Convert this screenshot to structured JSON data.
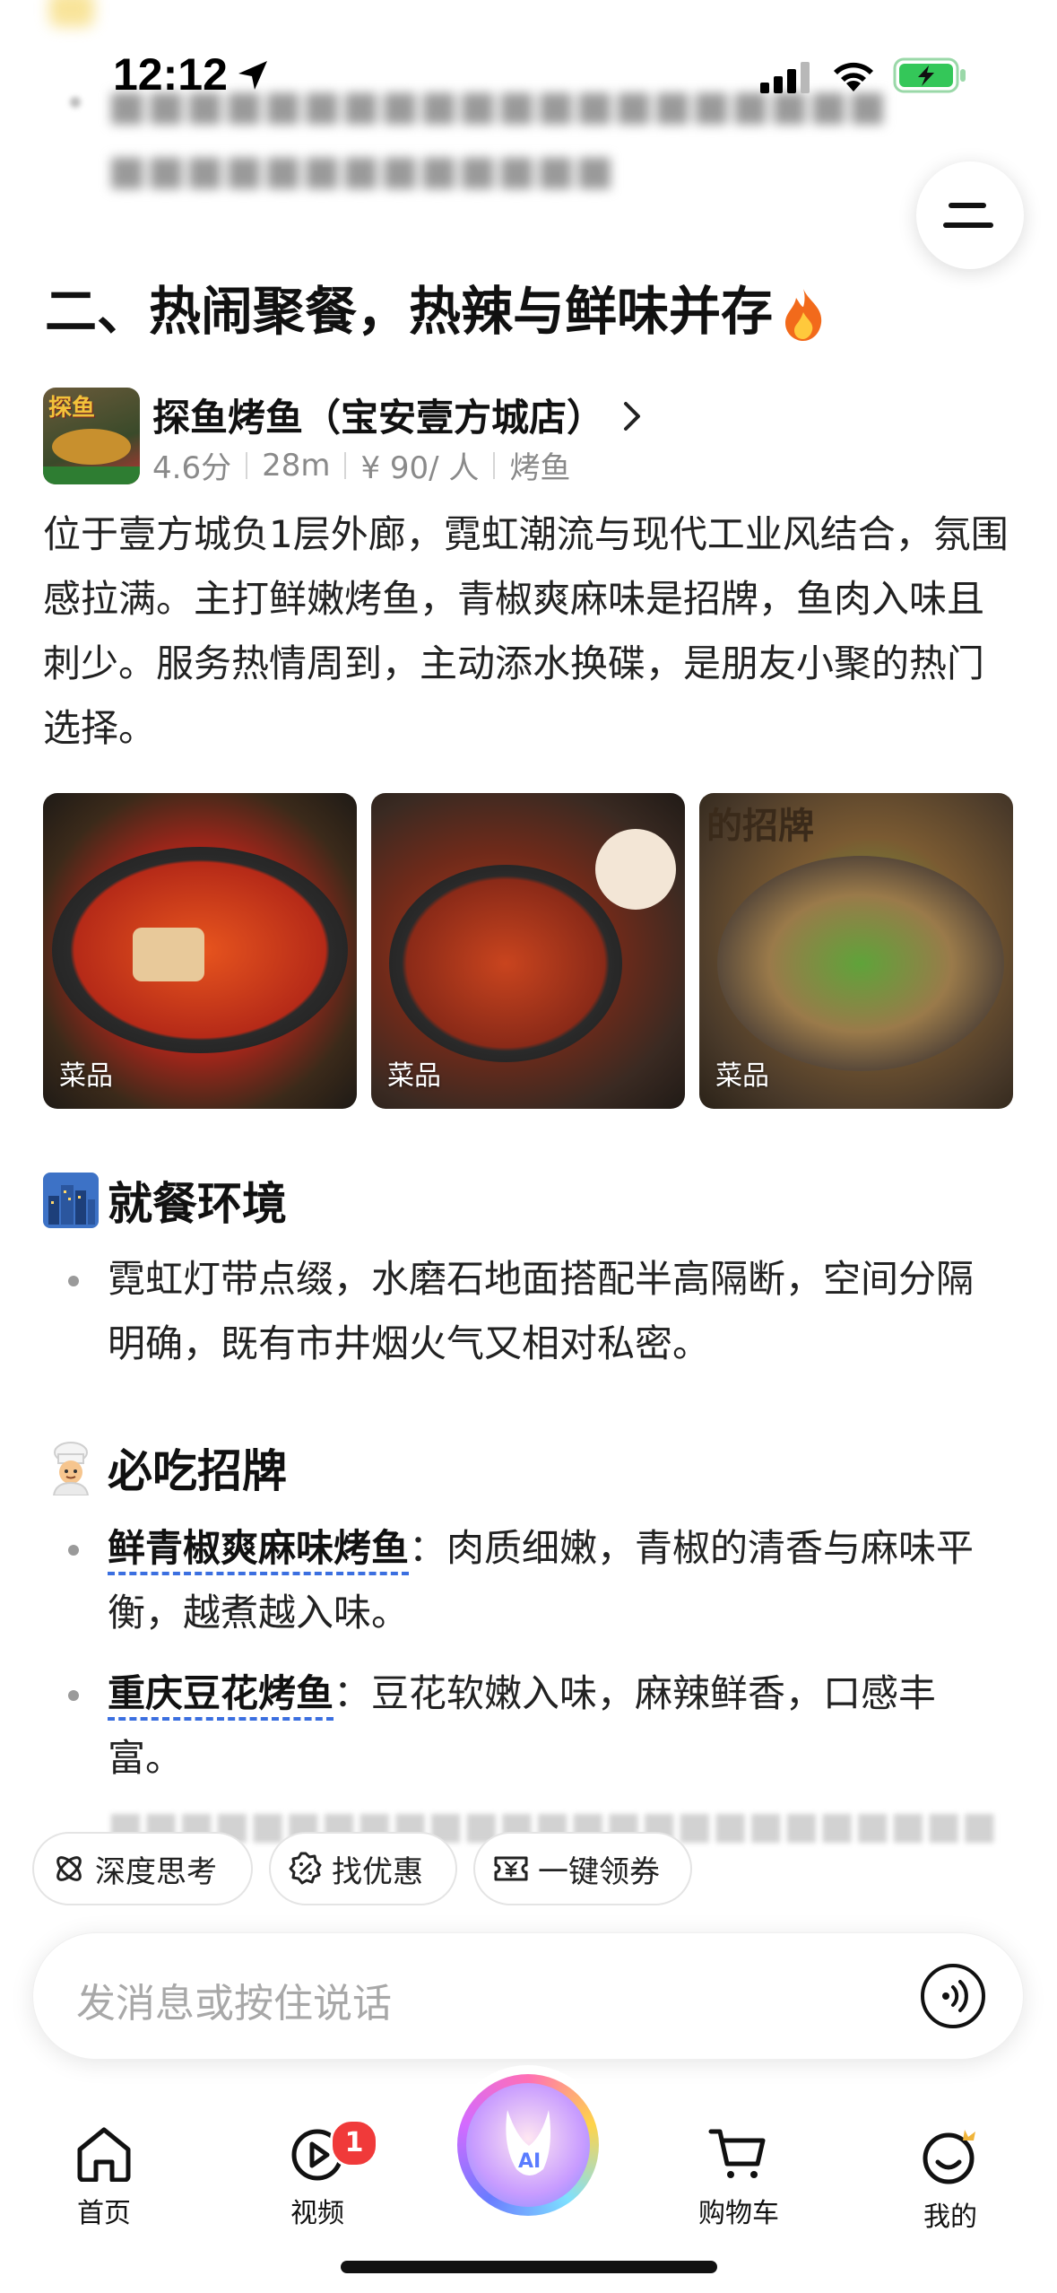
{
  "status_bar": {
    "time": "12:12"
  },
  "article": {
    "section_title": "二、热闹聚餐，热辣与鲜味并存",
    "store": {
      "name": "探鱼烤鱼（宝安壹方城店）",
      "rating": "4.6分",
      "distance": "28m",
      "price": "¥ 90/ 人",
      "category": "烤鱼",
      "thumb_text": "探鱼"
    },
    "description": "位于壹方城负1层外廊，霓虹潮流与现代工业风结合，氛围感拉满。主打鲜嫩烤鱼，青椒爽麻味是招牌，鱼肉入味且刺少。服务热情周到，主动添水换碟，是朋友小聚的热门选择。",
    "photos": [
      {
        "label": "菜品",
        "icon": "grilled-fish-photo"
      },
      {
        "label": "菜品",
        "icon": "grilled-fish-photo"
      },
      {
        "label": "菜品",
        "icon": "grilled-fish-photo",
        "overlay_text": "的招牌"
      }
    ],
    "environment": {
      "heading": "就餐环境",
      "items": [
        "霓虹灯带点缀，水磨石地面搭配半高隔断，空间分隔明确，既有市井烟火气又相对私密。"
      ]
    },
    "must_eat": {
      "heading": "必吃招牌",
      "items": [
        {
          "name": "鲜青椒爽麻味烤鱼",
          "sep": "：",
          "text": "肉质细嫩，青椒的清香与麻味平衡，越煮越入味。"
        },
        {
          "name": "重庆豆花烤鱼",
          "sep": "：",
          "text": "豆花软嫩入味，麻辣鲜香，口感丰富。"
        }
      ]
    }
  },
  "quick_actions": [
    {
      "label": "深度思考",
      "icon": "deep-think-icon"
    },
    {
      "label": "找优惠",
      "icon": "discount-icon"
    },
    {
      "label": "一键领券",
      "icon": "coupon-icon"
    }
  ],
  "input": {
    "placeholder": "发消息或按住说话"
  },
  "bottom_nav": {
    "items": [
      {
        "label": "首页",
        "icon": "home-icon"
      },
      {
        "label": "视频",
        "icon": "video-icon",
        "badge": "1"
      },
      {
        "label": "购物车",
        "icon": "cart-icon"
      },
      {
        "label": "我的",
        "icon": "profile-icon"
      }
    ]
  },
  "colors": {
    "link_underline": "#3b6fe0",
    "badge": "#f03a3a",
    "battery": "#34c759"
  }
}
